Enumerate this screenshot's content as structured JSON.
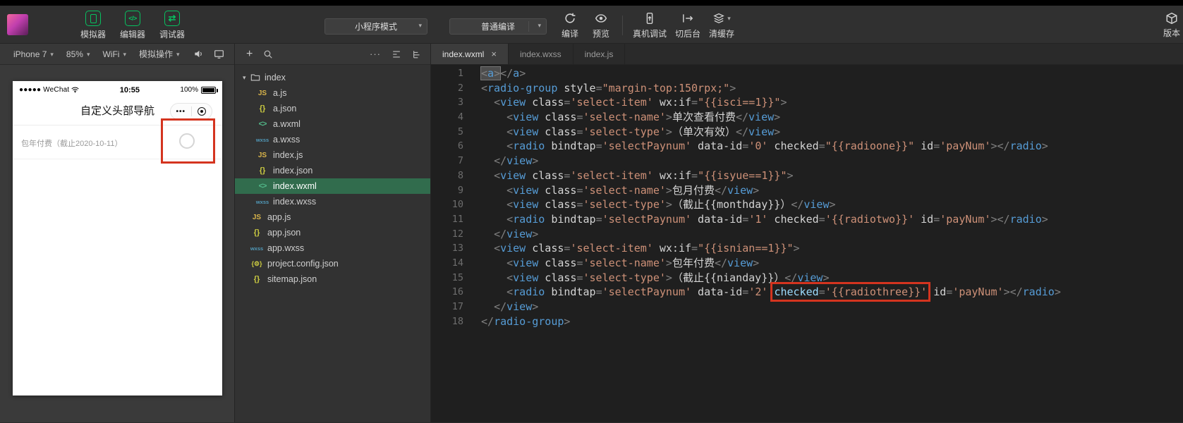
{
  "icons": {
    "caret_down": "▾",
    "plus": "+",
    "ellipsis": "···",
    "close": "×",
    "code_glyph": "</>",
    "swap_glyph": "⇄"
  },
  "toolbar": {
    "sim_buttons": [
      {
        "label": "模拟器"
      },
      {
        "label": "编辑器"
      },
      {
        "label": "调试器"
      }
    ],
    "mode_dropdown": {
      "value": "小程序模式"
    },
    "compile_dropdown": {
      "value": "普通编译"
    },
    "actions": [
      {
        "label": "编译"
      },
      {
        "label": "预览"
      },
      {
        "label": "真机调试"
      },
      {
        "label": "切后台"
      },
      {
        "label": "清缓存"
      }
    ],
    "version_label": "版本"
  },
  "device_bar": {
    "device": "iPhone 7",
    "zoom": "85%",
    "network": "WiFi",
    "sim_menu": "模拟操作"
  },
  "phone": {
    "carrier": "●●●●● WeChat",
    "time": "10:55",
    "battery": "100%",
    "nav_title": "自定义头部导航",
    "capsule_dots": "•••",
    "pay_row": "包年付费（截止2020-10-11）"
  },
  "file_tree": {
    "folder_name": "index",
    "items": [
      {
        "name": "a.js",
        "type": "js",
        "indent": 1
      },
      {
        "name": "a.json",
        "type": "json",
        "indent": 1
      },
      {
        "name": "a.wxml",
        "type": "wxml",
        "indent": 1
      },
      {
        "name": "a.wxss",
        "type": "wxss",
        "indent": 1
      },
      {
        "name": "index.js",
        "type": "js",
        "indent": 1
      },
      {
        "name": "index.json",
        "type": "json",
        "indent": 1
      },
      {
        "name": "index.wxml",
        "type": "wxml",
        "indent": 1,
        "selected": true
      },
      {
        "name": "index.wxss",
        "type": "wxss",
        "indent": 1
      },
      {
        "name": "app.js",
        "type": "js",
        "indent": 0
      },
      {
        "name": "app.json",
        "type": "json",
        "indent": 0
      },
      {
        "name": "app.wxss",
        "type": "wxss",
        "indent": 0
      },
      {
        "name": "project.config.json",
        "type": "config",
        "indent": 0
      },
      {
        "name": "sitemap.json",
        "type": "json",
        "indent": 0
      }
    ]
  },
  "file_badges": {
    "js": "JS",
    "json": "{}",
    "wxml": "<>",
    "wxss": "wxss",
    "config": "{⚙}"
  },
  "tabs": [
    {
      "label": "index.wxml",
      "active": true
    },
    {
      "label": "index.wxss",
      "active": false
    },
    {
      "label": "index.js",
      "active": false
    }
  ],
  "editor": {
    "lines": [
      "<a></a>",
      "<radio-group style=\"margin-top:150rpx;\">",
      "  <view class='select-item' wx:if=\"{{isci==1}}\">",
      "    <view class='select-name'>单次查看付费</view>",
      "    <view class='select-type'>（单次有效）</view>",
      "    <radio bindtap='selectPaynum' data-id='0' checked=\"{{radioone}}\" id='payNum'></radio>",
      "  </view>",
      "  <view class='select-item' wx:if=\"{{isyue==1}}\">",
      "    <view class='select-name'>包月付费</view>",
      "    <view class='select-type'>（截止{{monthday}}）</view>",
      "    <radio bindtap='selectPaynum' data-id='1' checked='{{radiotwo}}' id='payNum'></radio>",
      "  </view>",
      "  <view class='select-item' wx:if=\"{{isnian==1}}\">",
      "    <view class='select-name'>包年付费</view>",
      "    <view class='select-type'>（截止{{nianday}}）</view>",
      "    <radio bindtap='selectPaynum' data-id='2' checked='{{radiothree}}' id='payNum'></radio>",
      "  </view>",
      "</radio-group>"
    ],
    "annotations": [
      {
        "line": 1,
        "text": "<a>",
        "style": "sel-box"
      },
      {
        "line": 16,
        "text": "checked='{{radiothree}}'",
        "style": "red-box"
      }
    ]
  }
}
